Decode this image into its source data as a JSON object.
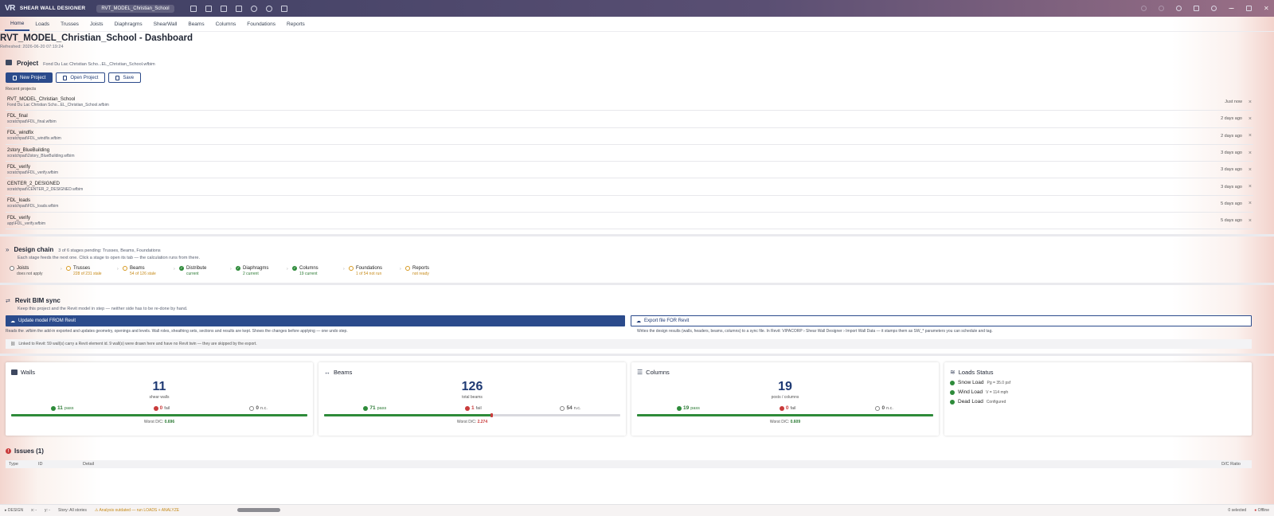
{
  "titlebar": {
    "logo": "VR",
    "app_name": "SHEAR WALL DESIGNER",
    "file_name": "RVT_MODEL_Christian_School"
  },
  "nav": {
    "tabs": [
      "Home",
      "Loads",
      "Trusses",
      "Joists",
      "Diaphragms",
      "ShearWall",
      "Beams",
      "Columns",
      "Foundations",
      "Reports"
    ],
    "active": "Home"
  },
  "page": {
    "title": "RVT_MODEL_Christian_School - Dashboard",
    "refreshed": "Refreshed: 2026-06-20 07:19:24"
  },
  "project": {
    "title": "Project",
    "current_path": "Fond Du Lac Christian Scho...EL_Christian_School.wfbim",
    "buttons": {
      "new": "New Project",
      "open": "Open Project",
      "save": "Save"
    },
    "recent_label": "Recent projects",
    "recent": [
      {
        "name": "RVT_MODEL_Christian_School",
        "path": "Fond Du Lac Christian Scho...EL_Christian_School.wfbim",
        "time": "Just now"
      },
      {
        "name": "FDL_final",
        "path": "scratchpad\\FDL_final.wfbim",
        "time": "2 days ago"
      },
      {
        "name": "FDL_windfix",
        "path": "scratchpad\\FDL_windfix.wfbim",
        "time": "2 days ago"
      },
      {
        "name": "2story_BlueBuilding",
        "path": "scratchpad\\2story_BlueBuilding.wfbim",
        "time": "3 days ago"
      },
      {
        "name": "FDL_verify",
        "path": "scratchpad\\FDL_verify.wfbim",
        "time": "3 days ago"
      },
      {
        "name": "CENTER_2_DESIGNED",
        "path": "scratchpad\\CENTER_2_DESIGNED.wfbim",
        "time": "3 days ago"
      },
      {
        "name": "FDL_loads",
        "path": "scratchpad\\FDL_loads.wfbim",
        "time": "5 days ago"
      },
      {
        "name": "FDL_verify",
        "path": "app\\FDL_verify.wfbim",
        "time": "5 days ago"
      }
    ],
    "remove_glyph": "×"
  },
  "design_chain": {
    "title": "Design chain",
    "summary": "3 of 6 stages pending: Trusses, Beams, Foundations",
    "hint": "Each stage feeds the next one. Click a stage to open its tab — the calculation runs from there.",
    "stages": [
      {
        "name": "Joists",
        "status": "does not apply",
        "state": "na"
      },
      {
        "name": "Trusses",
        "status": "228 of 231 stale",
        "state": "warn"
      },
      {
        "name": "Beams",
        "status": "54 of 126 stale",
        "state": "warn"
      },
      {
        "name": "Distribute",
        "status": "current",
        "state": "ok"
      },
      {
        "name": "Diaphragms",
        "status": "2 current",
        "state": "ok"
      },
      {
        "name": "Columns",
        "status": "19 current",
        "state": "ok"
      },
      {
        "name": "Foundations",
        "status": "1 of 54 not run",
        "state": "warn"
      },
      {
        "name": "Reports",
        "status": "not ready",
        "state": "warn"
      }
    ]
  },
  "revit_sync": {
    "title": "Revit BIM sync",
    "subtitle": "Keep this project and the Revit model in step — neither side has to be re-done by hand.",
    "update_label": "Update model FROM Revit",
    "export_label": "Export file FOR Revit",
    "update_desc": "Reads the .wfbim the add-in exported and updates geometry, openings and levels. Wall roles, sheathing sets, sections and results are kept. Shows the changes before applying — one undo step.",
    "export_desc": "Writes the design results (walls, headers, beams, columns) to a sync file. In Revit: VIPACORP › Shear Wall Designer › Import Wall Data — it stamps them as SW_* parameters you can schedule and tag.",
    "linked_note": "Linked to Revit: 59 wall(s) carry a Revit element id. 9 wall(s) were drawn here and have no Revit twin — they are skipped by the export."
  },
  "cards": {
    "walls": {
      "title": "Walls",
      "count": "11",
      "unit": "shear walls",
      "pass": "11",
      "fail": "0",
      "nc": "0",
      "pass_label": "pass",
      "fail_label": "fail",
      "nc_label": "n.c.",
      "worst_label": "Worst D/C:",
      "worst": "0.696",
      "pass_fraction": 1.0
    },
    "beams": {
      "title": "Beams",
      "count": "126",
      "unit": "total beams",
      "pass": "71",
      "fail": "1",
      "nc": "54",
      "pass_label": "pass",
      "fail_label": "fail",
      "nc_label": "n.c.",
      "worst_label": "Worst D/C:",
      "worst": "2.274",
      "pass_fraction": 0.5635
    },
    "columns": {
      "title": "Columns",
      "count": "19",
      "unit": "posts / columns",
      "pass": "19",
      "fail": "0",
      "nc": "0",
      "pass_label": "pass",
      "fail_label": "fail",
      "nc_label": "n.c.",
      "worst_label": "Worst D/C:",
      "worst": "0.609",
      "pass_fraction": 1.0
    },
    "loads": {
      "title": "Loads Status",
      "items": [
        {
          "name": "Snow Load",
          "value": "Pg = 35.0 psf"
        },
        {
          "name": "Wind Load",
          "value": "V = 114 mph"
        },
        {
          "name": "Dead Load",
          "value": "Configured"
        }
      ]
    }
  },
  "issues": {
    "title": "Issues (1)",
    "columns": {
      "type": "Type",
      "id": "ID",
      "detail": "Detail",
      "ratio": "D/C Ratio"
    }
  },
  "statusbar": {
    "mode": "DESIGN",
    "x": "x: -",
    "y": "y: -",
    "story": "Story: All stories",
    "warning": "Analysis outdated — run LOADS + ANALYZE",
    "selected": "0 selected",
    "connection": "Offline"
  },
  "colors": {
    "accent": "#2b4b8c",
    "pass": "#2e8b3a",
    "fail": "#c93b3b",
    "warn": "#c68a18"
  }
}
